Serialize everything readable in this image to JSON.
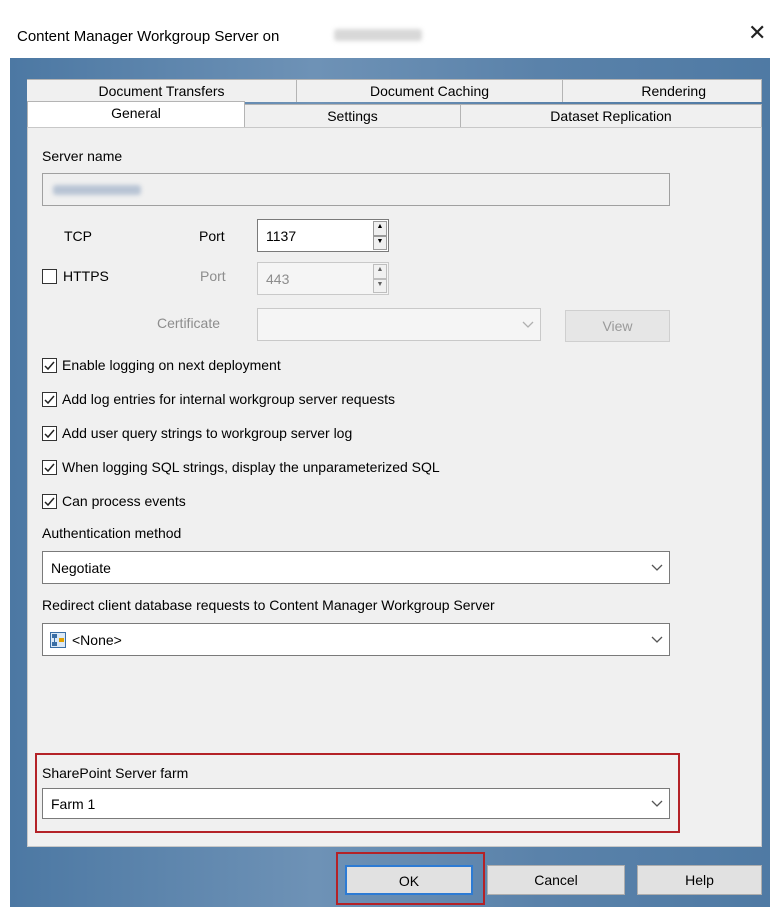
{
  "window": {
    "title": "Content Manager Workgroup Server on",
    "close": "✕"
  },
  "tabs": {
    "row_back": [
      "Document Transfers",
      "Document Caching",
      "Rendering"
    ],
    "row_front": [
      "General",
      "Settings",
      "Dataset Replication"
    ]
  },
  "general": {
    "server_name_label": "Server name",
    "tcp_label": "TCP",
    "port_label": "Port",
    "tcp_port": "1137",
    "https_label": "HTTPS",
    "https_port_label": "Port",
    "https_port": "443",
    "certificate_label": "Certificate",
    "view_button": "View",
    "checkboxes": [
      {
        "label": "Enable logging on next deployment",
        "checked": true
      },
      {
        "label": "Add log entries for internal workgroup server requests",
        "checked": true
      },
      {
        "label": "Add user query strings to workgroup server log",
        "checked": true
      },
      {
        "label": "When logging SQL strings, display the unparameterized SQL",
        "checked": true
      },
      {
        "label": "Can process events",
        "checked": true
      }
    ],
    "auth_label": "Authentication method",
    "auth_value": "Negotiate",
    "redirect_label": "Redirect client database requests to Content Manager Workgroup Server",
    "redirect_value": "<None>",
    "farm_label": "SharePoint Server farm",
    "farm_value": "Farm 1"
  },
  "buttons": {
    "ok": "OK",
    "cancel": "Cancel",
    "help": "Help"
  },
  "colors": {
    "highlight": "#b42227",
    "tab_active": "#ffffff",
    "panel": "#f0f0f0",
    "frame": "#5b84ab",
    "ok_border": "#2d7bd4"
  }
}
